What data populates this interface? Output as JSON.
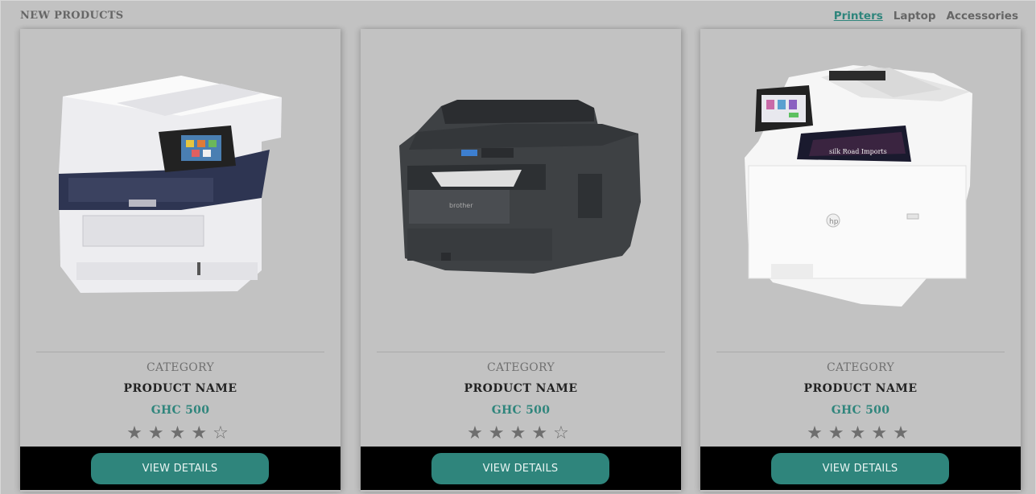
{
  "section": {
    "title": "NEW PRODUCTS"
  },
  "filters": [
    {
      "label": "Printers",
      "active": true
    },
    {
      "label": "Laptop",
      "active": false
    },
    {
      "label": "Accessories",
      "active": false
    }
  ],
  "products": [
    {
      "image_icon": "white-printer-icon",
      "category": "CATEGORY",
      "name": "PRODUCT NAME",
      "price": "GHC 500",
      "rating": 4,
      "max_rating": 5,
      "button_label": "VIEW DETAILS"
    },
    {
      "image_icon": "dark-printer-icon",
      "category": "CATEGORY",
      "name": "PRODUCT NAME",
      "price": "GHC 500",
      "rating": 4,
      "max_rating": 5,
      "button_label": "VIEW DETAILS"
    },
    {
      "image_icon": "hp-printer-icon",
      "category": "CATEGORY",
      "name": "PRODUCT NAME",
      "price": "GHC 500",
      "rating": 5,
      "max_rating": 5,
      "button_label": "VIEW DETAILS"
    }
  ],
  "colors": {
    "accent": "#2f857c",
    "background": "#c2c2c2",
    "button_bar": "#000000",
    "star": "#6e6e6e"
  }
}
